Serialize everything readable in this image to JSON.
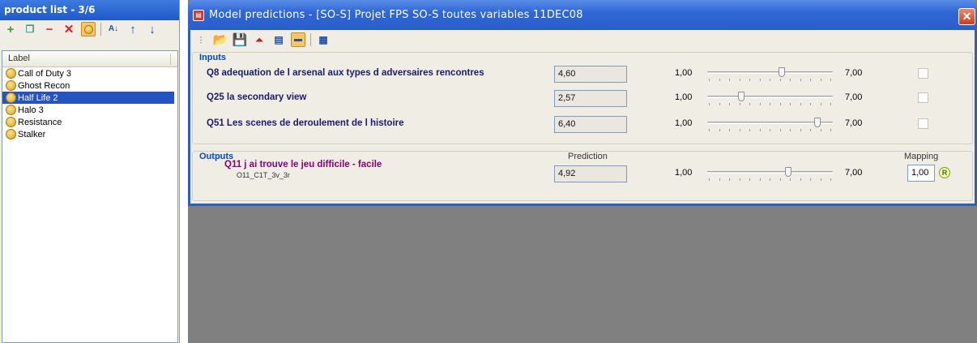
{
  "left_panel": {
    "title": "product list - 3/6",
    "list_header": "Label",
    "products": [
      {
        "label": "Call of Duty 3",
        "selected": false
      },
      {
        "label": "Ghost Recon",
        "selected": false
      },
      {
        "label": "Half Life 2",
        "selected": true
      },
      {
        "label": "Halo 3",
        "selected": false
      },
      {
        "label": "Resistance",
        "selected": false
      },
      {
        "label": "Stalker",
        "selected": false
      }
    ],
    "toolbar_icons": [
      "add-icon",
      "copy-icon",
      "minus-icon",
      "delete-icon",
      "lock-icon",
      "sort-icon",
      "move-up-icon",
      "move-down-icon"
    ]
  },
  "window": {
    "title": "Model predictions - [SO-S] Projet FPS SO-S toutes variables 11DEC08",
    "close_label": "✕",
    "toolbar_icons": [
      "open-icon",
      "save-icon",
      "chart-icon",
      "document-icon",
      "highlight-icon",
      "grid-icon"
    ]
  },
  "inputs": {
    "label": "Inputs",
    "rows": [
      {
        "label": "Q8 adequation de l arsenal aux types d adversaires rencontres",
        "value": "4,60",
        "min": "1,00",
        "max": "7,00",
        "level": 4.6
      },
      {
        "label": "Q25 la secondary view",
        "value": "2,57",
        "min": "1,00",
        "max": "7,00",
        "level": 2.57
      },
      {
        "label": "Q51 Les scenes de deroulement de l histoire",
        "value": "6,40",
        "min": "1,00",
        "max": "7,00",
        "level": 6.4
      }
    ]
  },
  "outputs": {
    "label": "Outputs",
    "prediction_header": "Prediction",
    "mapping_header": "Mapping",
    "row": {
      "label": "Q11 j ai trouve le jeu difficile - facile",
      "code": "O11_C1T_3v_3r",
      "value": "4,92",
      "min": "1,00",
      "max": "7,00",
      "level": 4.92,
      "mapping": "1,00",
      "mapping_icon": "R"
    }
  },
  "colors": {
    "accent": "#2a5fcb",
    "input_label": "#1a1a6e",
    "output_label": "#8a007a",
    "group_label": "#0046d5",
    "selection": "#2453c3"
  }
}
